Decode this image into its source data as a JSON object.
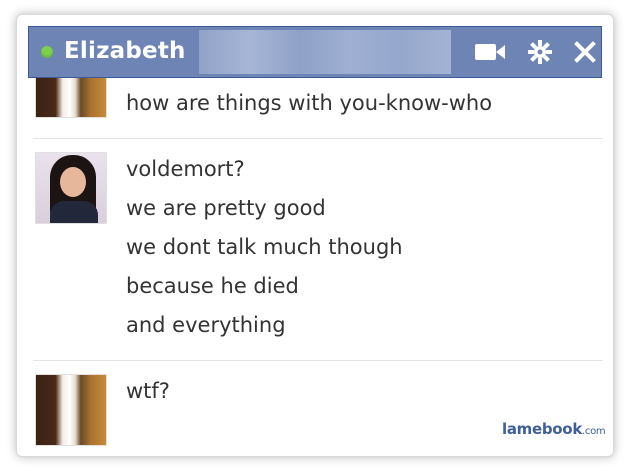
{
  "chat": {
    "contact_name": "Elizabeth",
    "status": "online",
    "header_icons": [
      "video-icon",
      "gear-icon",
      "close-icon"
    ],
    "colors": {
      "header": "#6d84b4",
      "header_border": "#3b5998",
      "online_dot": "#7dd14a",
      "text": "#333333"
    }
  },
  "messages": [
    {
      "sender_avatar": "couple-photo",
      "lines": [
        "how are things with you-know-who"
      ]
    },
    {
      "sender_avatar": "girl-photo",
      "lines": [
        "voldemort?",
        "we are pretty good",
        "we dont talk much though",
        "because he died",
        "and everything"
      ]
    },
    {
      "sender_avatar": "couple-photo",
      "lines": [
        "wtf?"
      ]
    }
  ],
  "watermark": {
    "brand": "lamebook",
    "suffix": ".com"
  }
}
